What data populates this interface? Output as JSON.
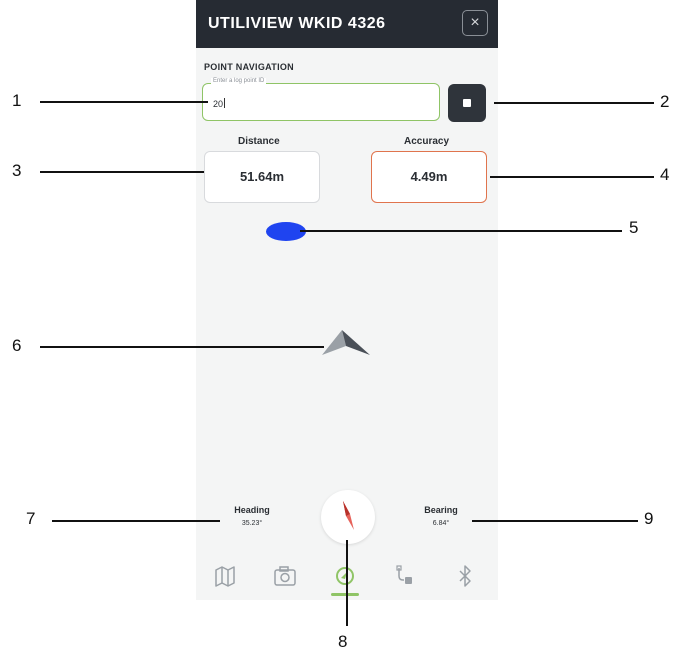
{
  "app": {
    "title": "UTILIVIEW WKID 4326",
    "close_label": "×"
  },
  "point_navigation": {
    "section_label": "POINT NAVIGATION",
    "input_placeholder": "Enter a log point ID",
    "input_value": "20"
  },
  "metrics": {
    "distance_label": "Distance",
    "distance_value": "51.64m",
    "accuracy_label": "Accuracy",
    "accuracy_value": "4.49m"
  },
  "footer": {
    "heading_label": "Heading",
    "heading_value": "35.23°",
    "bearing_label": "Bearing",
    "bearing_value": "6.84°"
  },
  "tabs": [
    {
      "icon": "map-icon",
      "active": false
    },
    {
      "icon": "camera-icon",
      "active": false
    },
    {
      "icon": "navigation-icon",
      "active": true
    },
    {
      "icon": "device-icon",
      "active": false
    },
    {
      "icon": "bluetooth-icon",
      "active": false
    }
  ],
  "callouts": [
    "1",
    "2",
    "3",
    "4",
    "5",
    "6",
    "7",
    "8",
    "9"
  ],
  "colors": {
    "titlebar": "#262b33",
    "input_border": "#8fc466",
    "accuracy_border": "#e0744d",
    "position_dot": "#1f44f0",
    "active_tab": "#8fc466"
  }
}
